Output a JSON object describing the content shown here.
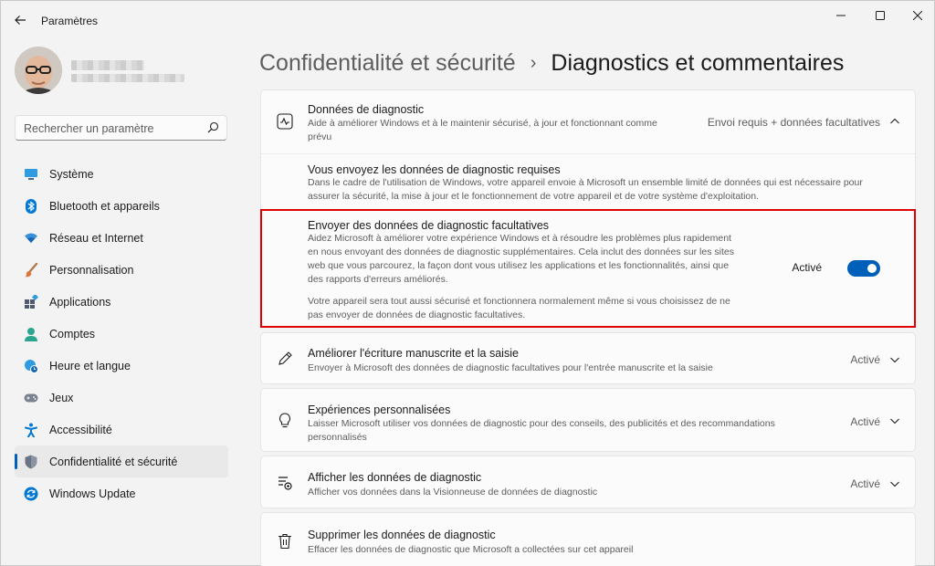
{
  "window": {
    "title": "Paramètres"
  },
  "search": {
    "placeholder": "Rechercher un paramètre"
  },
  "sidebar": {
    "items": [
      {
        "label": "Système",
        "icon": "system-icon",
        "color": "#0078d4"
      },
      {
        "label": "Bluetooth et appareils",
        "icon": "bluetooth-icon",
        "color": "#0078d4"
      },
      {
        "label": "Réseau et Internet",
        "icon": "wifi-icon",
        "color": "#0078d4"
      },
      {
        "label": "Personnalisation",
        "icon": "brush-icon",
        "color": "#e0743a"
      },
      {
        "label": "Applications",
        "icon": "apps-icon",
        "color": "#505a6e"
      },
      {
        "label": "Comptes",
        "icon": "person-icon",
        "color": "#2ba58f"
      },
      {
        "label": "Heure et langue",
        "icon": "globe-clock-icon",
        "color": "#0078d4"
      },
      {
        "label": "Jeux",
        "icon": "gamepad-icon",
        "color": "#6b7280"
      },
      {
        "label": "Accessibilité",
        "icon": "accessibility-icon",
        "color": "#0078d4"
      },
      {
        "label": "Confidentialité et sécurité",
        "icon": "shield-icon",
        "color": "#7b8393",
        "active": true
      },
      {
        "label": "Windows Update",
        "icon": "update-icon",
        "color": "#0078d4"
      }
    ]
  },
  "breadcrumb": {
    "parent": "Confidentialité et sécurité",
    "separator": "›",
    "current": "Diagnostics et commentaires"
  },
  "diagnostic_card": {
    "title": "Données de diagnostic",
    "desc_line1": "Aide à améliorer Windows et à le maintenir sécurisé, à jour et fonctionnant comme",
    "desc_line2": "prévu",
    "status": "Envoi requis + données facultatives",
    "required": {
      "title": "Vous envoyez les données de diagnostic requises",
      "line1": "Dans le cadre de l'utilisation de Windows, votre appareil envoie à Microsoft un ensemble limité de données qui est nécessaire pour",
      "line2": "assurer la sécurité, la mise à jour et le fonctionnement de votre appareil et de votre système d'exploitation."
    },
    "optional": {
      "title": "Envoyer des données de diagnostic facultatives",
      "line1": "Aidez Microsoft à améliorer votre expérience Windows et à résoudre les problèmes plus rapidement",
      "line2": "en nous envoyant des données de diagnostic supplémentaires. Cela inclut des données sur les sites",
      "line3": "web que vous parcourez, la façon dont vous utilisez les applications et les fonctionnalités, ainsi que",
      "line4": "des rapports d'erreurs améliorés.",
      "line5": "Votre appareil sera tout aussi sécurisé et fonctionnera normalement même si vous choisissez de ne",
      "line6": "pas envoyer de données de diagnostic facultatives.",
      "toggle_label": "Activé",
      "toggle_on": true
    }
  },
  "cards": [
    {
      "title": "Améliorer l'écriture manuscrite et la saisie",
      "desc_line1": "Envoyer à Microsoft des données de diagnostic facultatives pour l'entrée manuscrite et la saisie",
      "desc_line2": "",
      "status": "Activé",
      "icon": "pen-icon"
    },
    {
      "title": "Expériences personnalisées",
      "desc_line1": "Laisser Microsoft utiliser vos données de diagnostic pour des conseils, des publicités et des recommandations",
      "desc_line2": "personnalisés",
      "status": "Activé",
      "icon": "lightbulb-icon"
    },
    {
      "title": "Afficher les données de diagnostic",
      "desc_line1": "Afficher vos données dans la Visionneuse de données de diagnostic",
      "desc_line2": "",
      "status": "Activé",
      "icon": "data-viewer-icon"
    },
    {
      "title": "Supprimer les données de diagnostic",
      "desc_line1": "Effacer les données de diagnostic que Microsoft a collectées sur cet appareil",
      "desc_line2": "",
      "status": "",
      "icon": "trash-icon"
    }
  ],
  "colors": {
    "accent": "#005fb8",
    "highlight_border": "#e00000"
  }
}
